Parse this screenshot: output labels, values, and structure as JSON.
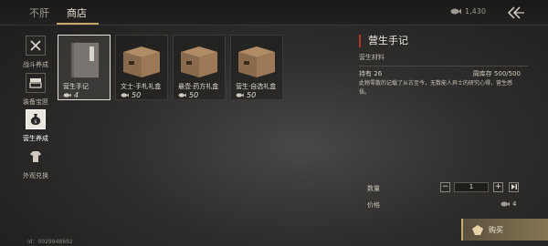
{
  "tabs": [
    {
      "label": "不肝",
      "active": false
    },
    {
      "label": "商店",
      "active": true
    }
  ],
  "currency": {
    "icon": "fish-coin-icon",
    "amount": "1,430"
  },
  "categories": [
    {
      "label": "战斗养成",
      "icon": "crossed-swords-icon",
      "active": false
    },
    {
      "label": "装备宝匣",
      "icon": "chest-icon",
      "active": false
    },
    {
      "label": "营生养成",
      "icon": "money-bag-icon",
      "active": true
    },
    {
      "label": "外观兑换",
      "icon": "outfit-icon",
      "active": false
    }
  ],
  "items": [
    {
      "name": "营生手记",
      "qty": "4",
      "icon": "notebook-icon",
      "selected": true
    },
    {
      "name": "文士·手札礼盒",
      "qty": "50",
      "icon": "wooden-box-icon",
      "selected": false
    },
    {
      "name": "悬壶·药方礼盒",
      "qty": "50",
      "icon": "wooden-box-icon",
      "selected": false
    },
    {
      "name": "营生·自选礼盒",
      "qty": "50",
      "icon": "wooden-box-icon",
      "selected": false
    }
  ],
  "detail": {
    "title": "营生手记",
    "subtitle": "营生材料",
    "owned_label": "持有",
    "owned_value": "26",
    "stock_label": "周库存",
    "stock_value": "500/500",
    "description": "此物零散的记载了从古至今，无数能人异士的研究心得，营生感悟。"
  },
  "purchase": {
    "qty_label": "数量",
    "qty_value": "1",
    "price_label": "价格",
    "price_value": "4",
    "buy_label": "购买"
  },
  "uid": "id：0029948692",
  "colors": {
    "accent": "#c9a86a",
    "title_bar": "#b3362a",
    "buy_bg": "#867552"
  }
}
